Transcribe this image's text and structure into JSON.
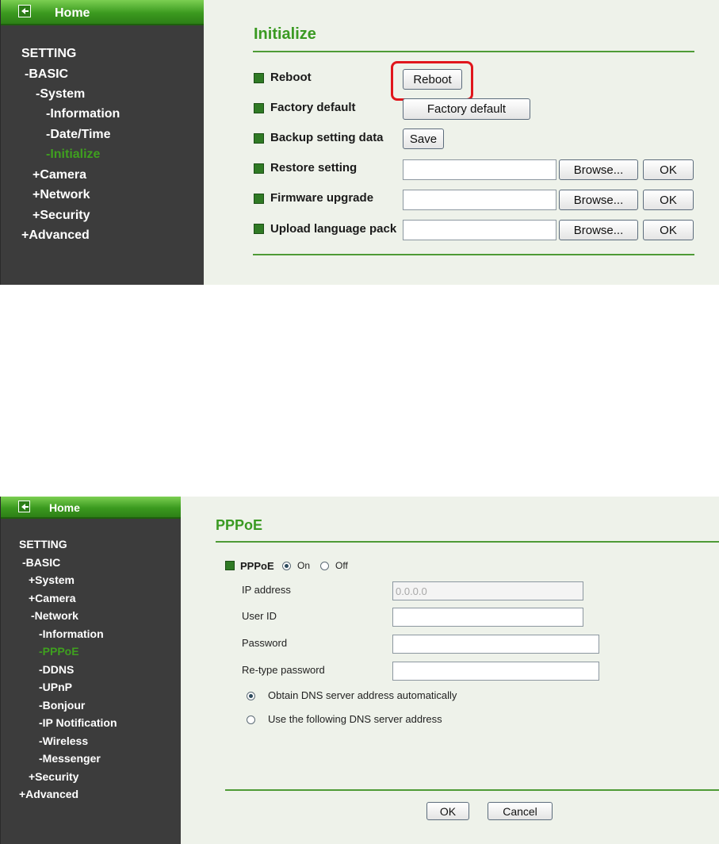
{
  "initialize": {
    "sidebar": {
      "home": "Home",
      "setting": "SETTING",
      "basic": "-BASIC",
      "system": "-System",
      "information": "-Information",
      "datetime": "-Date/Time",
      "initialize": "-Initialize",
      "camera": "+Camera",
      "network": "+Network",
      "security": "+Security",
      "advanced": "+Advanced"
    },
    "title": "Initialize",
    "rows": {
      "reboot_label": "Reboot",
      "reboot_button": "Reboot",
      "factory_label": "Factory default",
      "factory_button": "Factory default",
      "backup_label": "Backup setting data",
      "save_button": "Save",
      "restore_label": "Restore setting",
      "firmware_label": "Firmware upgrade",
      "language_label": "Upload language pack",
      "browse_button": "Browse...",
      "ok_button": "OK"
    },
    "colors": {
      "accent": "#3a9a22",
      "highlight": "#e0161c",
      "sidebar": "#3c3c3c"
    }
  },
  "pppoe": {
    "sidebar": {
      "home": "Home",
      "setting": "SETTING",
      "basic": "-BASIC",
      "system": "+System",
      "camera": "+Camera",
      "network": "-Network",
      "information": "-Information",
      "pppoe": "-PPPoE",
      "ddns": "-DDNS",
      "upnp": "-UPnP",
      "bonjour": "-Bonjour",
      "ip_notification": "-IP Notification",
      "wireless": "-Wireless",
      "messenger": "-Messenger",
      "security": "+Security",
      "advanced": "+Advanced"
    },
    "title": "PPPoE",
    "pppoe_label": "PPPoE",
    "on_label": "On",
    "off_label": "Off",
    "pppoe_state": "On",
    "fields": {
      "ip_label": "IP address",
      "ip_value": "0.0.0.0",
      "user_label": "User ID",
      "user_value": "",
      "password_label": "Password",
      "password_value": "",
      "retype_label": "Re-type password",
      "retype_value": ""
    },
    "dns": {
      "auto_label": "Obtain DNS server address automatically",
      "manual_label": "Use the following DNS server address",
      "selected": "auto"
    },
    "ok_button": "OK",
    "cancel_button": "Cancel"
  }
}
